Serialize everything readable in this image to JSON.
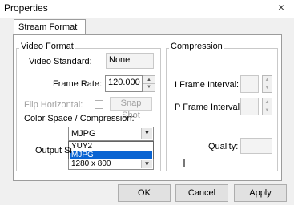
{
  "window": {
    "title": "Properties",
    "close_glyph": "×"
  },
  "tabs": [
    {
      "label": "Stream Format"
    }
  ],
  "video_format": {
    "legend": "Video Format",
    "video_standard": {
      "label": "Video Standard:",
      "value": "None"
    },
    "frame_rate": {
      "label": "Frame Rate:",
      "value": "120.000"
    },
    "flip_horizontal": {
      "label": "Flip Horizontal:"
    },
    "snap_shot": {
      "label": "Snap Shot"
    },
    "color_space": {
      "label": "Color Space / Compression:",
      "selected": "MJPG",
      "options": [
        "YUY2",
        "MJPG"
      ],
      "highlighted": "MJPG"
    },
    "output_size": {
      "label": "Output Si",
      "value": "1280 x 800"
    }
  },
  "compression": {
    "legend": "Compression",
    "i_frame": {
      "label": "I Frame Interval:",
      "value": ""
    },
    "p_frame": {
      "label": "P Frame Interval:",
      "value": ""
    },
    "quality": {
      "label": "Quality:",
      "value": ""
    },
    "quality_level": 0
  },
  "buttons": {
    "ok": "OK",
    "cancel": "Cancel",
    "apply": "Apply"
  },
  "icons": {
    "close": "close-icon",
    "spin_up": "▲",
    "spin_down": "▼",
    "combo_arrow": "▼"
  }
}
